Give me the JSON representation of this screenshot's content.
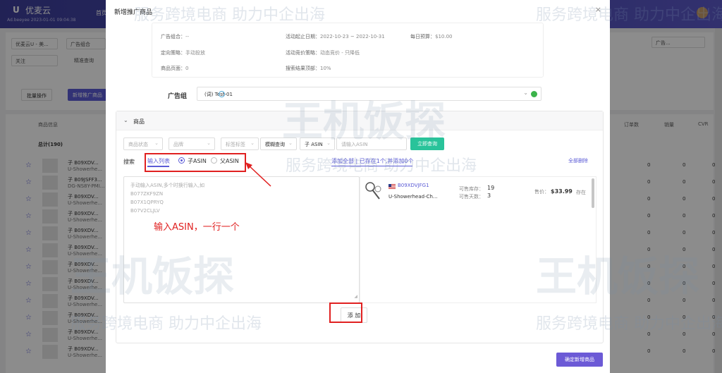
{
  "background": {
    "logo": "优麦云",
    "logo_mark": "U",
    "subtitle": "Ad.beeyee 2023-01-01 09:04:38",
    "nav_item": "首页",
    "filters": {
      "store": "优麦云U - 美...",
      "group": "广告组合",
      "follow": "关注",
      "precise": "精准查询",
      "ad_status_right": "广告..."
    },
    "batch_label": "批量操作",
    "new_btn": "新增推广商品",
    "table_headers": {
      "product_info": "商品信息",
      "orders": "订单数",
      "sales": "销量",
      "cvr": "CVR"
    },
    "total_label": "总计(190)",
    "rows": [
      {
        "t1": "子 B09XDV...",
        "t2": "U-Showerhe..."
      },
      {
        "t1": "子 B09JSFF3...",
        "t2": "DG-NS8Y-PMI..."
      },
      {
        "t1": "子 B09XDV...",
        "t2": "U-Showerhe..."
      },
      {
        "t1": "子 B09XDV...",
        "t2": "U-Showerhe..."
      },
      {
        "t1": "子 B09XDV...",
        "t2": "U-Showerhe..."
      },
      {
        "t1": "子 B09XDV...",
        "t2": "U-Showerhe..."
      },
      {
        "t1": "子 B09XDV...",
        "t2": "U-Showerhe..."
      },
      {
        "t1": "子 B09XDV...",
        "t2": "U-Showerhe..."
      },
      {
        "t1": "子 B09XDV...",
        "t2": "U-Showerhe..."
      },
      {
        "t1": "子 B09XDV...",
        "t2": "U-Showerhe..."
      },
      {
        "t1": "子 B09XDV...",
        "t2": "U-Showerhe..."
      },
      {
        "t1": "子 B09XDV...",
        "t2": "U-Showerhe..."
      }
    ],
    "zero": "0"
  },
  "modal": {
    "title": "新增推广商品",
    "close": "×",
    "summary": {
      "portfolio_k": "广告组合：",
      "portfolio_v": "--",
      "dates_k": "活动起止日期：",
      "dates_v": "2022-10-23 ~ 2022-10-31",
      "budget_k": "每日预算：",
      "budget_v": "$10.00",
      "targeting_k": "定向策略：",
      "targeting_v": "手动投放",
      "bidding_k": "活动竞价策略：",
      "bidding_v": "动态竞价 - 只降低",
      "product_page_k": "商品页面：",
      "product_page_v": "0",
      "top_search_k": "搜索结果顶部：",
      "top_search_v": "10%"
    },
    "ad_group_label": "广告组",
    "ad_group_value": "(词)    Test-01",
    "products_label": "商品",
    "filters": {
      "status": "商品状态",
      "brand": "品牌",
      "tag": "标签标签",
      "fuzzy": "模糊查询",
      "child_asin": "子 ASIN",
      "asin_placeholder": "请输入ASIN",
      "search_btn": "立即查询"
    },
    "search_label": "搜索",
    "input_list_tab": "输入列表",
    "radio_child": "子ASIN",
    "radio_parent": "父ASIN",
    "add_all_link": "添加全部",
    "added_count_link": "已存在1个,并添加0个",
    "clear_all": "全部删除",
    "asin_placeholder_lines": [
      "手动输入ASIN,多个时换行输入,如",
      "B077ZKF9ZN",
      "B07X1QPRYQ",
      "B07V2CLJLV"
    ],
    "result": {
      "asin": "B09XDVJFG1",
      "title": "U-Showerhead-Ch...",
      "stock_k": "可售库存：",
      "stock_v": "19",
      "days_k": "可售天数：",
      "days_v": "3",
      "price_k": "售价：",
      "price_v": "$33.99",
      "status": "存在"
    },
    "add_btn": "添 加",
    "confirm_btn": "确定新增商品",
    "annotation": "输入ASIN，一行一个"
  },
  "watermark": {
    "line": "服务跨境电商  助力中企出海",
    "big": "王机饭探"
  },
  "colors": {
    "accent": "#5b5bd6",
    "search_btn": "#29c39a",
    "confirm": "#6c5ad6",
    "annotation": "#e02020"
  }
}
